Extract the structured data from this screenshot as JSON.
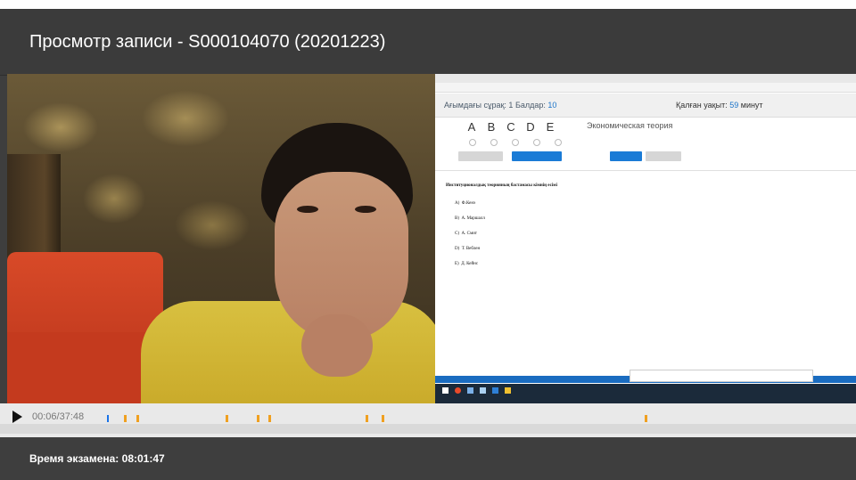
{
  "header": {
    "title": "Просмотр записи - S000104070 (20201223)"
  },
  "exam_screen": {
    "question_label": "Ағымдағы сұрақ:",
    "question_number": "1",
    "score_label": "Балдар:",
    "score_value": "10",
    "time_label": "Қалған уақыт:",
    "time_value": "59",
    "time_unit": "минут",
    "options": [
      "A",
      "B",
      "C",
      "D",
      "E"
    ],
    "subject": "Экономическая теория",
    "question_text": "Институционалдық теорияның бастамасы кімнің есімі",
    "answers": [
      {
        "letter": "A)",
        "text": "Ф.Кенэ"
      },
      {
        "letter": "B)",
        "text": "А. Маршалл"
      },
      {
        "letter": "C)",
        "text": "А. Смит"
      },
      {
        "letter": "D)",
        "text": "Т. Веблен"
      },
      {
        "letter": "E)",
        "text": "Д. Кейнс"
      }
    ]
  },
  "player": {
    "play_icon": "play-icon",
    "timecode": "00:06/37:48",
    "progress_fraction": 0.0027,
    "event_markers": [
      0.032,
      0.048,
      0.166,
      0.207,
      0.223,
      0.352,
      0.373,
      0.72
    ]
  },
  "footer": {
    "exam_time": "Время экзамена: 08:01:47"
  },
  "colors": {
    "marker": "#f0a020",
    "playhead": "#1a73e8",
    "accent": "#1a7bd6"
  }
}
